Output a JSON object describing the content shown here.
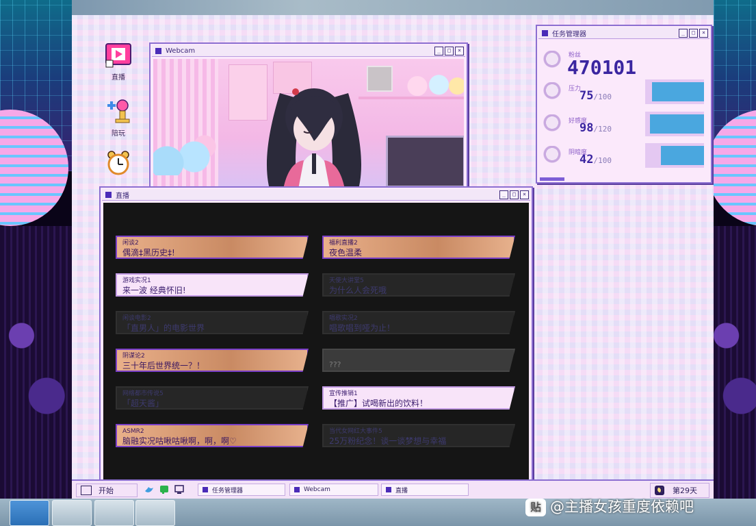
{
  "desktop_icons": [
    {
      "label": "直播",
      "icon": "stream-app-icon"
    },
    {
      "label": "陪玩",
      "icon": "game-controller-icon"
    },
    {
      "label": "",
      "icon": "alarm-clock-icon"
    }
  ],
  "webcam_window": {
    "title": "Webcam"
  },
  "task_manager": {
    "title": "任务管理器",
    "followers": {
      "label": "粉丝",
      "value": "470101"
    },
    "stats": [
      {
        "label": "压力",
        "value": "75",
        "max": "/100",
        "level": 0.75,
        "color": "#4aa7df"
      },
      {
        "label": "好感度",
        "value": "98",
        "max": "/120",
        "level": 0.82,
        "color": "#4aa7df"
      },
      {
        "label": "阴暗度",
        "value": "42",
        "max": "/100",
        "level": 0.42,
        "color": "#4aa7df"
      }
    ]
  },
  "stream_window": {
    "title": "直播",
    "cards": [
      {
        "category": "闲谈2",
        "title": "偶滴‡黑历史‡!",
        "style": "gold"
      },
      {
        "category": "福利直播2",
        "title": "夜色温柔",
        "style": "gold"
      },
      {
        "category": "游戏实况1",
        "title": "来一波 经典怀旧!",
        "style": "pink"
      },
      {
        "category": "天使大讲堂5",
        "title": "为什么人会死哦",
        "style": "dark"
      },
      {
        "category": "闲谈电影2",
        "title": "「直男人」的电影世界",
        "style": "dark"
      },
      {
        "category": "唱歌实况2",
        "title": "唱歌唱到哑为止！",
        "style": "dark"
      },
      {
        "category": "阴谋论2",
        "title": "三十年后世界统一？！",
        "style": "gold"
      },
      {
        "category": "",
        "title": "???",
        "style": "unknown"
      },
      {
        "category": "网络都市传说5",
        "title": "「超天酱」",
        "style": "dark"
      },
      {
        "category": "宣传推销1",
        "title": "【推广】试喝新出的饮料！",
        "style": "pink"
      },
      {
        "category": "ASMR2",
        "title": "脑融实况咕啾咕啾啊，啊，啊♡",
        "style": "gold"
      },
      {
        "category": "当代女网红大事件5",
        "title": "25万粉纪念！谈一谈梦想与幸福",
        "style": "dark"
      }
    ]
  },
  "taskbar": {
    "start_label": "开始",
    "tasks": [
      {
        "label": "任务管理器"
      },
      {
        "label": "Webcam"
      },
      {
        "label": "直播"
      }
    ],
    "day_label": "第29天"
  },
  "os_taskbar": {
    "apps": [
      "windows-start-icon",
      "game-character-icon",
      "steam-icon",
      "paint-icon"
    ]
  },
  "watermark": {
    "text": "@主播女孩重度依赖吧",
    "logo": "贴"
  }
}
